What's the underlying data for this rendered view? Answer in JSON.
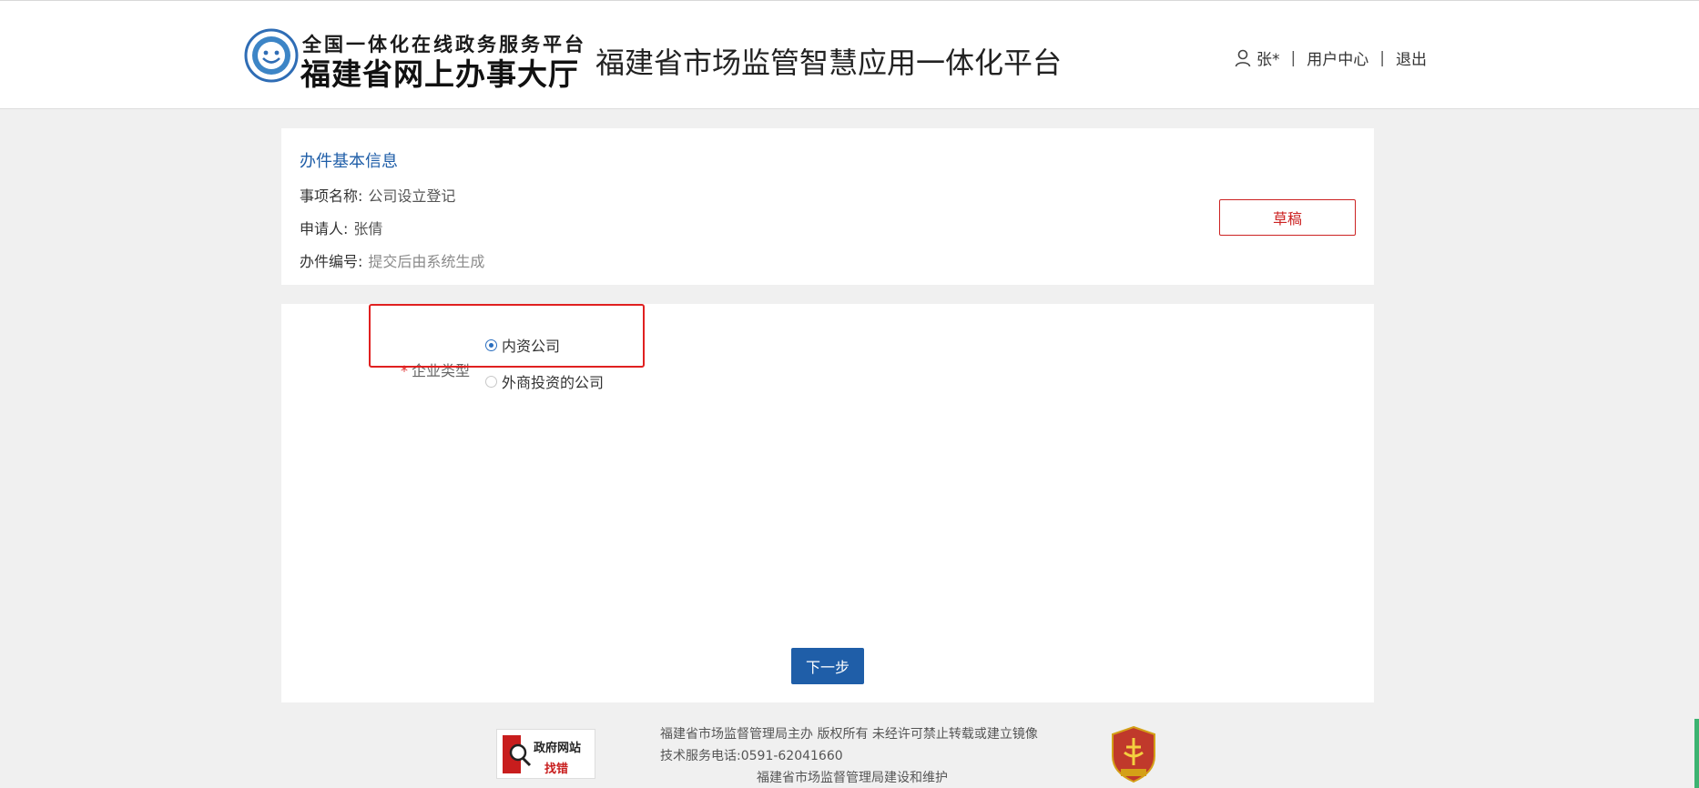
{
  "header": {
    "logo_top": "全国一体化在线政务服务平台",
    "logo_bottom": "福建省网上办事大厅",
    "platform_title": "福建省市场监管智慧应用一体化平台",
    "user_icon": "user-icon",
    "user_name": "张*",
    "separator": "|",
    "user_center": "用户中心",
    "logout": "退出"
  },
  "info_card": {
    "title": "办件基本信息",
    "item_label": "事项名称:",
    "item_value": "公司设立登记",
    "applicant_label": "申请人:",
    "applicant_value": "张倩",
    "number_label": "办件编号:",
    "number_value": "提交后由系统生成",
    "draft_button": "草稿"
  },
  "form": {
    "required_mark": "*",
    "enterprise_type_label": "企业类型",
    "options": [
      {
        "label": "内资公司",
        "checked": true
      },
      {
        "label": "外商投资的公司",
        "checked": false
      }
    ],
    "next_button": "下一步"
  },
  "footer": {
    "badge_left_line1": "政府网站",
    "badge_left_line2": "找错",
    "line1": "福建省市场监督管理局主办  版权所有  未经许可禁止转载或建立镜像",
    "line2": "技术服务电话:0591-62041660",
    "line3": "福建省市场监督管理局建设和维护",
    "badge_right_icon": "party-government-organ-emblem-icon"
  },
  "colors": {
    "primary": "#1f5ea8",
    "danger": "#cc2222",
    "background": "#f0f0f0"
  }
}
